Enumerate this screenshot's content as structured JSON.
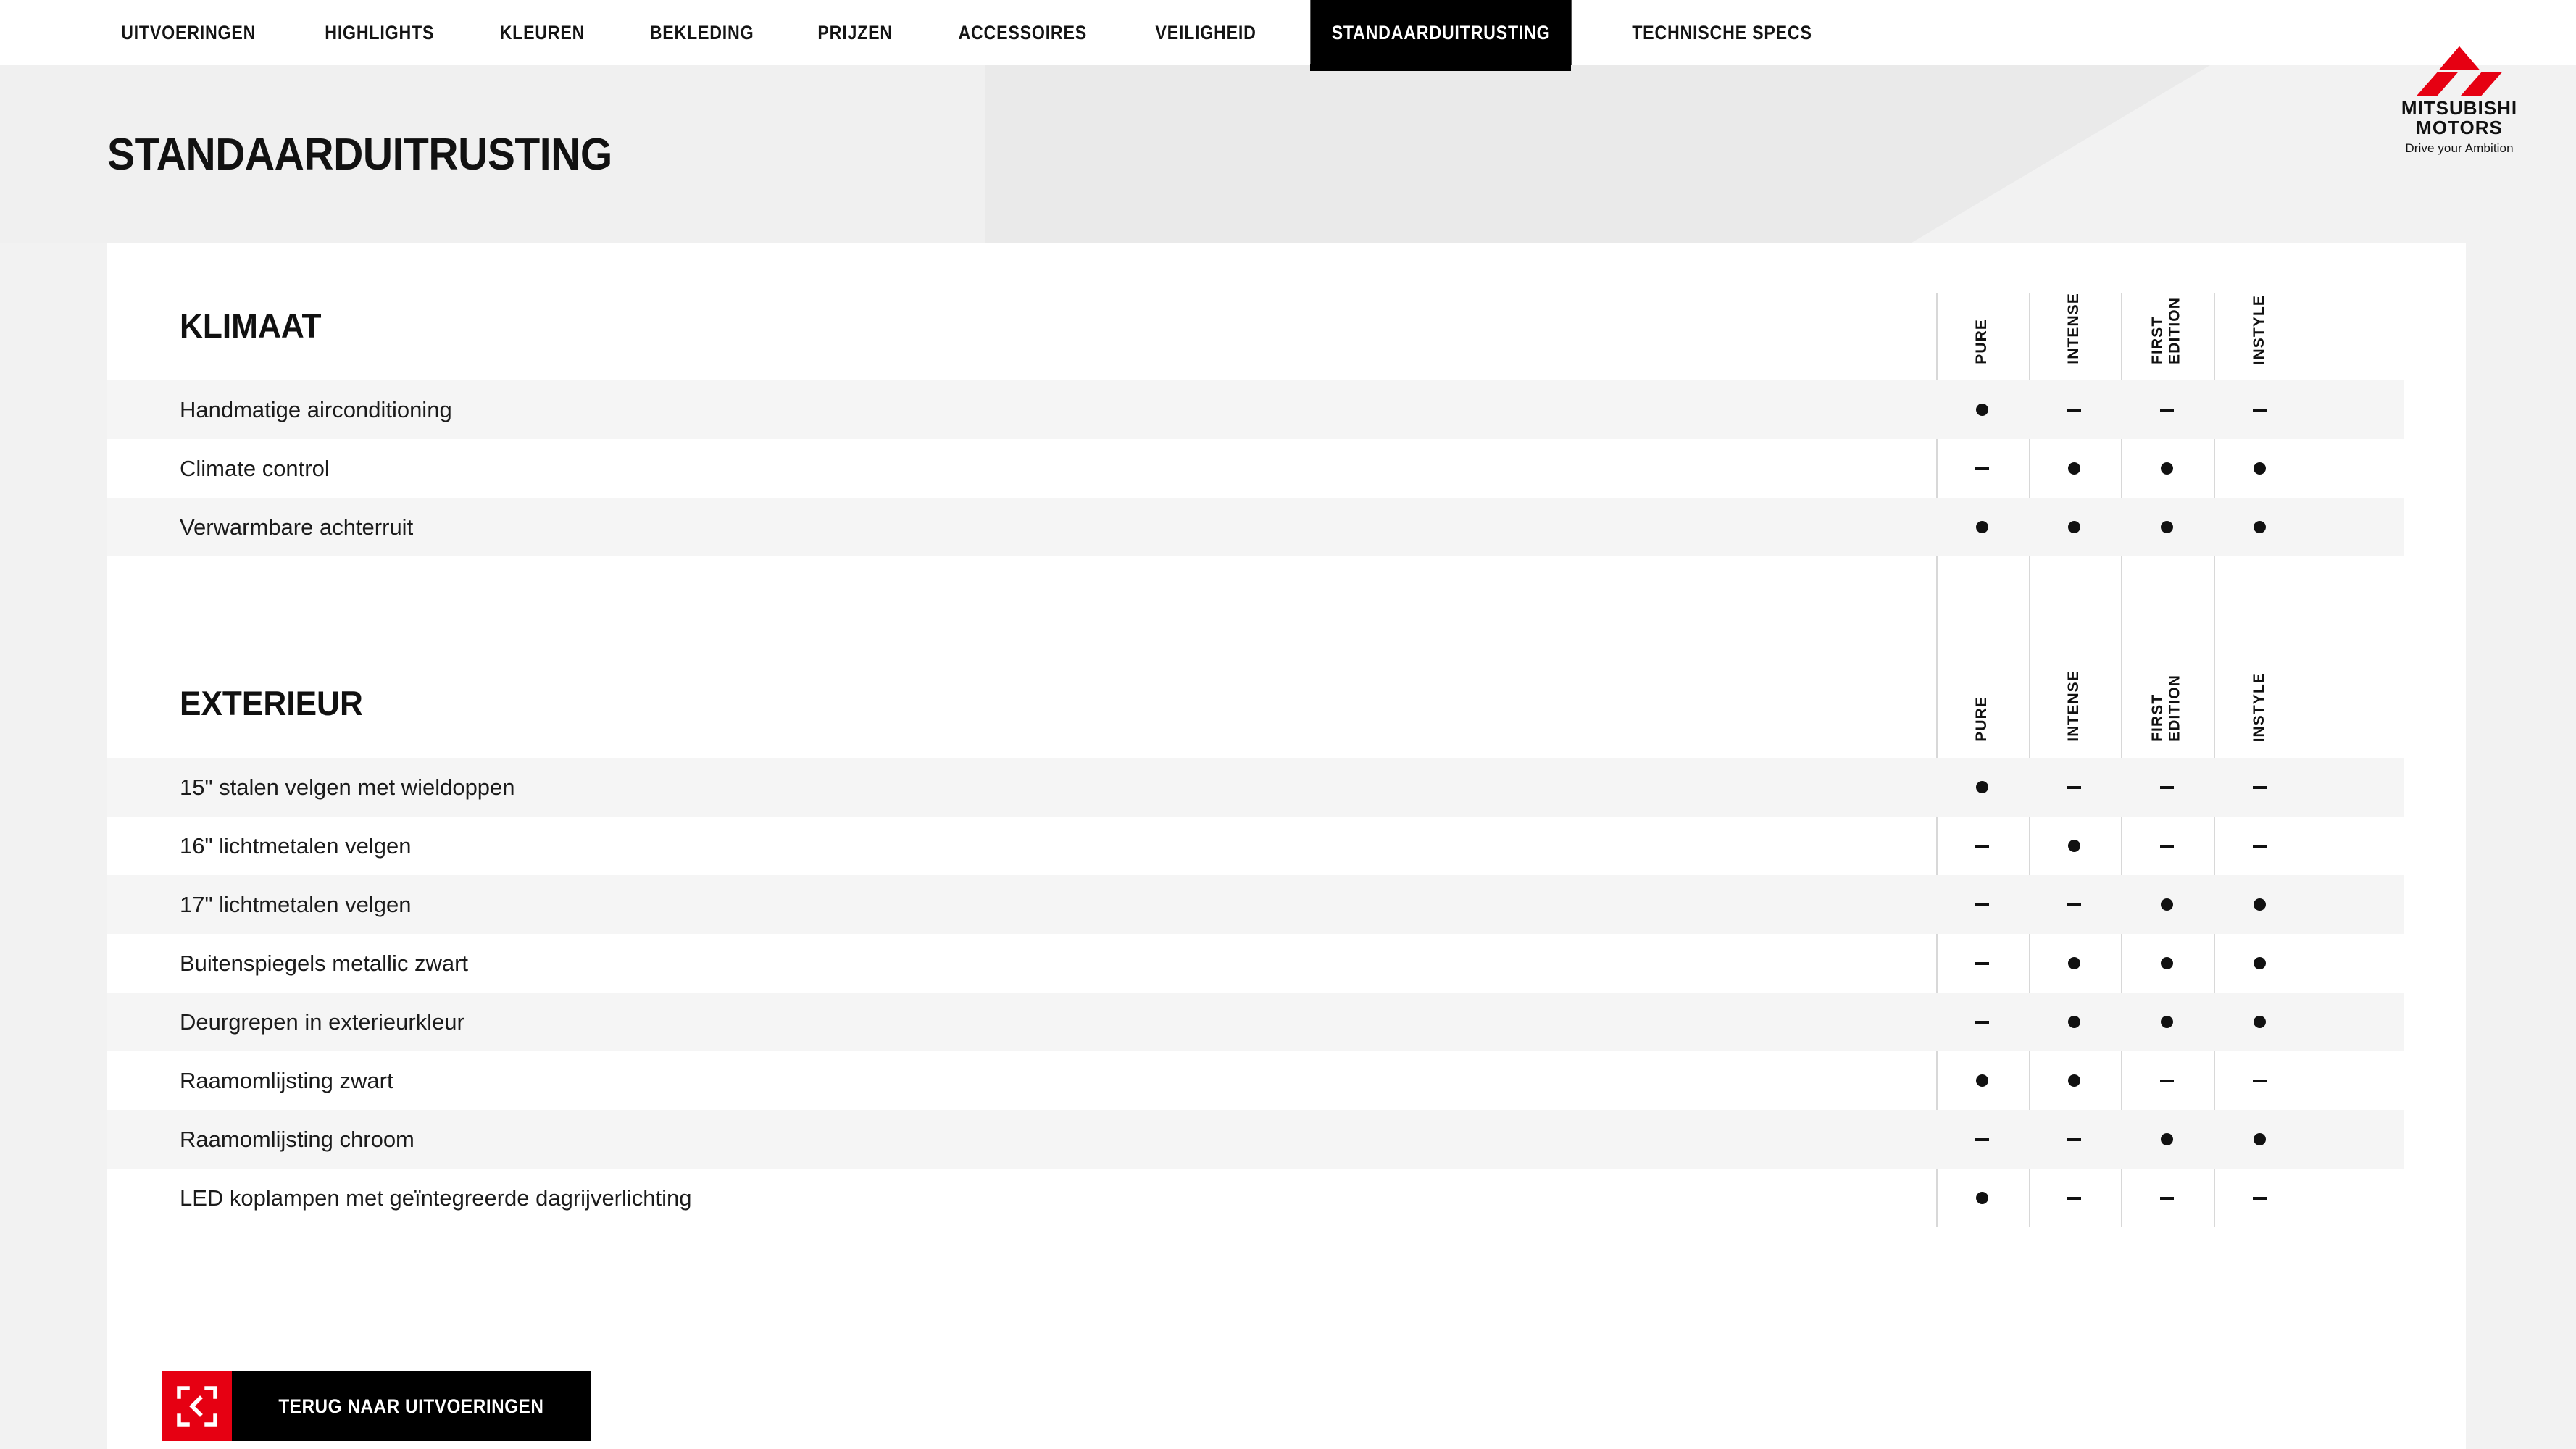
{
  "nav": {
    "items": [
      {
        "label": "UITVOERINGEN",
        "active": false
      },
      {
        "label": "HIGHLIGHTS",
        "active": false
      },
      {
        "label": "KLEUREN",
        "active": false
      },
      {
        "label": "BEKLEDING",
        "active": false
      },
      {
        "label": "PRIJZEN",
        "active": false
      },
      {
        "label": "ACCESSOIRES",
        "active": false
      },
      {
        "label": "VEILIGHEID",
        "active": false
      },
      {
        "label": "STANDAARDUITRUSTING",
        "active": true
      },
      {
        "label": "TECHNISCHE SPECS",
        "active": false
      }
    ]
  },
  "brand": {
    "name_line1": "MITSUBISHI",
    "name_line2": "MOTORS",
    "tagline": "Drive your Ambition",
    "logo_icon": "mitsubishi-three-diamonds-icon",
    "red": "#e60012"
  },
  "hero": {
    "title": "STANDAARDUITRUSTING"
  },
  "table": {
    "trims": [
      "PURE",
      "INTENSE",
      "FIRST\nEDITION",
      "INSTYLE"
    ],
    "symbols": {
      "included": "dot-icon",
      "excluded": "dash-icon"
    },
    "sections": [
      {
        "title": "KLIMAAT",
        "rows": [
          {
            "label": "Handmatige airconditioning",
            "values": [
              "dot",
              "dash",
              "dash",
              "dash"
            ]
          },
          {
            "label": "Climate control",
            "values": [
              "dash",
              "dot",
              "dot",
              "dot"
            ]
          },
          {
            "label": "Verwarmbare achterruit",
            "values": [
              "dot",
              "dot",
              "dot",
              "dot"
            ]
          }
        ]
      },
      {
        "title": "EXTERIEUR",
        "rows": [
          {
            "label": "15\" stalen velgen met wieldoppen",
            "values": [
              "dot",
              "dash",
              "dash",
              "dash"
            ]
          },
          {
            "label": "16\" lichtmetalen velgen",
            "values": [
              "dash",
              "dot",
              "dash",
              "dash"
            ]
          },
          {
            "label": "17\" lichtmetalen velgen",
            "values": [
              "dash",
              "dash",
              "dot",
              "dot"
            ]
          },
          {
            "label": "Buitenspiegels metallic zwart",
            "values": [
              "dash",
              "dot",
              "dot",
              "dot"
            ]
          },
          {
            "label": "Deurgrepen in exterieurkleur",
            "values": [
              "dash",
              "dot",
              "dot",
              "dot"
            ]
          },
          {
            "label": "Raamomlijsting zwart",
            "values": [
              "dot",
              "dot",
              "dash",
              "dash"
            ]
          },
          {
            "label": "Raamomlijsting chroom",
            "values": [
              "dash",
              "dash",
              "dot",
              "dot"
            ]
          },
          {
            "label": "LED koplampen met geïntegreerde dagrijverlichting",
            "values": [
              "dot",
              "dash",
              "dash",
              "dash"
            ]
          }
        ]
      }
    ]
  },
  "footer": {
    "back_button_label": "TERUG NAAR UITVOERINGEN",
    "back_button_icon": "back-chevron-frame-icon"
  }
}
